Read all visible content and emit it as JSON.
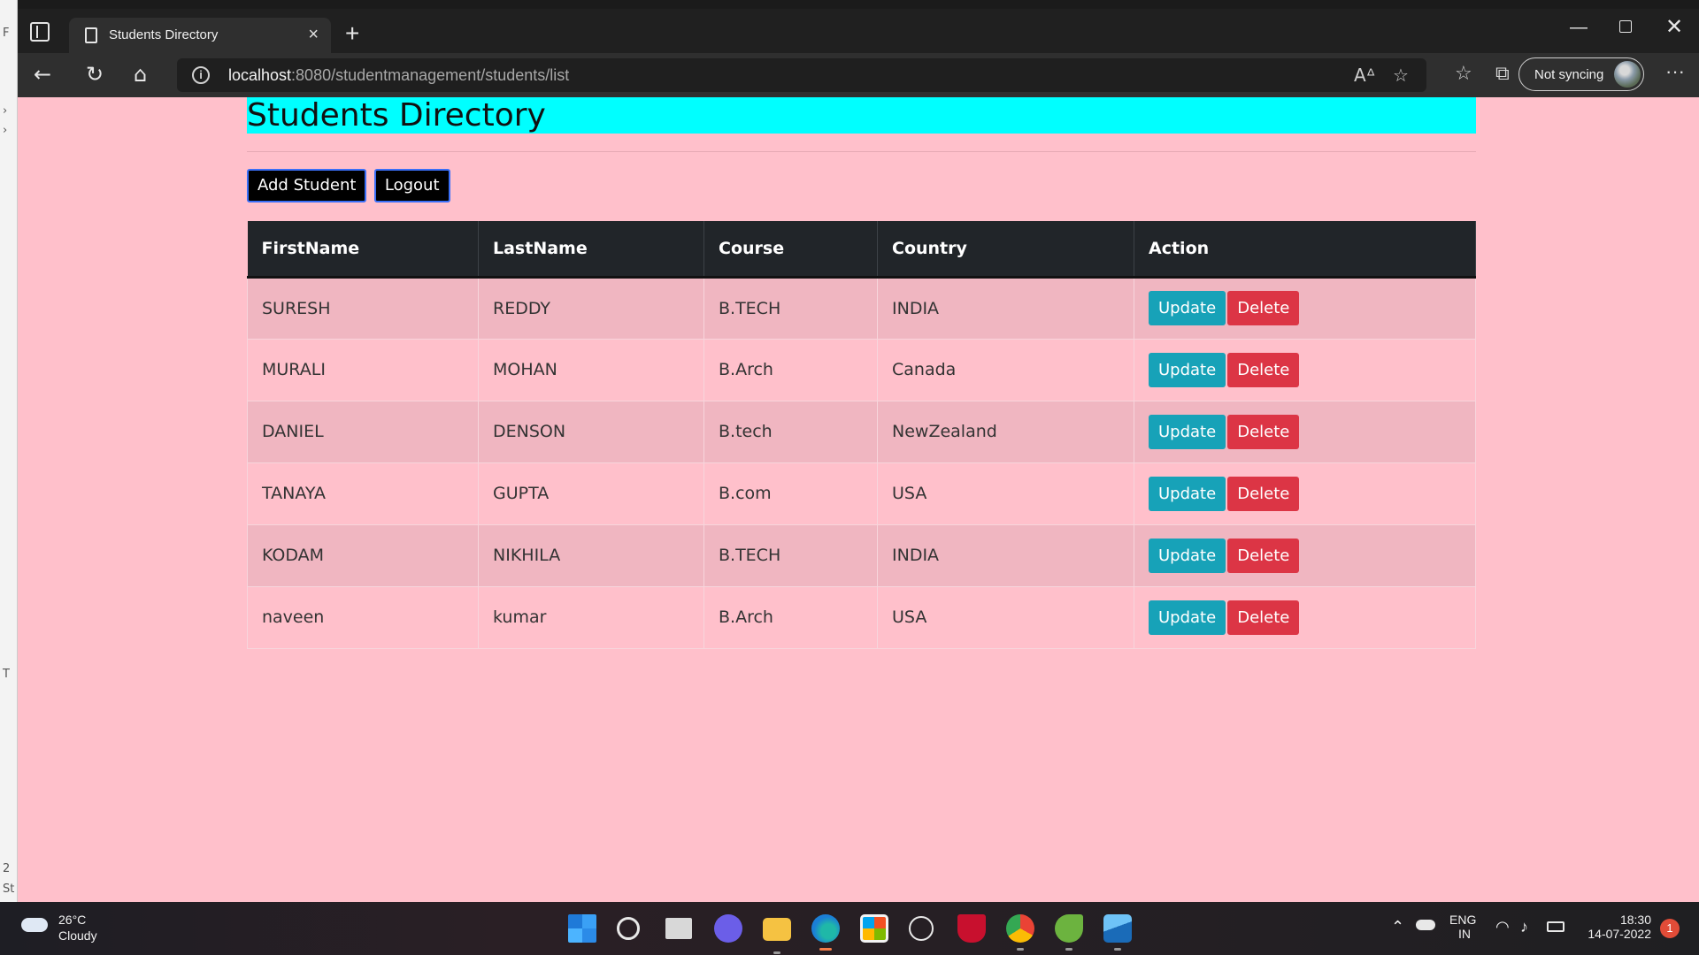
{
  "browser": {
    "tab_title": "Students Directory",
    "url_host": "localhost",
    "url_path": ":8080/studentmanagement/students/list",
    "sync_label": "Not syncing"
  },
  "page": {
    "heading": "Students Directory",
    "add_button": "Add Student",
    "logout_button": "Logout",
    "columns": [
      "FirstName",
      "LastName",
      "Course",
      "Country",
      "Action"
    ],
    "update_label": "Update",
    "delete_label": "Delete",
    "rows": [
      {
        "first": "SURESH",
        "last": "REDDY",
        "course": "B.TECH",
        "country": "INDIA"
      },
      {
        "first": "MURALI",
        "last": "MOHAN",
        "course": "B.Arch",
        "country": "Canada"
      },
      {
        "first": "DANIEL",
        "last": "DENSON",
        "course": "B.tech",
        "country": "NewZealand"
      },
      {
        "first": "TANAYA",
        "last": "GUPTA",
        "course": "B.com",
        "country": "USA"
      },
      {
        "first": "KODAM",
        "last": "NIKHILA",
        "course": "B.TECH",
        "country": "INDIA"
      },
      {
        "first": "naveen",
        "last": "kumar",
        "course": "B.Arch",
        "country": "USA"
      }
    ]
  },
  "taskbar": {
    "weather_temp": "26°C",
    "weather_cond": "Cloudy",
    "lang": "ENG",
    "region": "IN",
    "time": "18:30",
    "date": "14-07-2022",
    "notification_count": "1"
  },
  "colors": {
    "page_bg": "#ffc0cb",
    "heading_bg": "#00ffff",
    "update": "#17a2b8",
    "delete": "#dc3545",
    "table_head": "#212529"
  }
}
